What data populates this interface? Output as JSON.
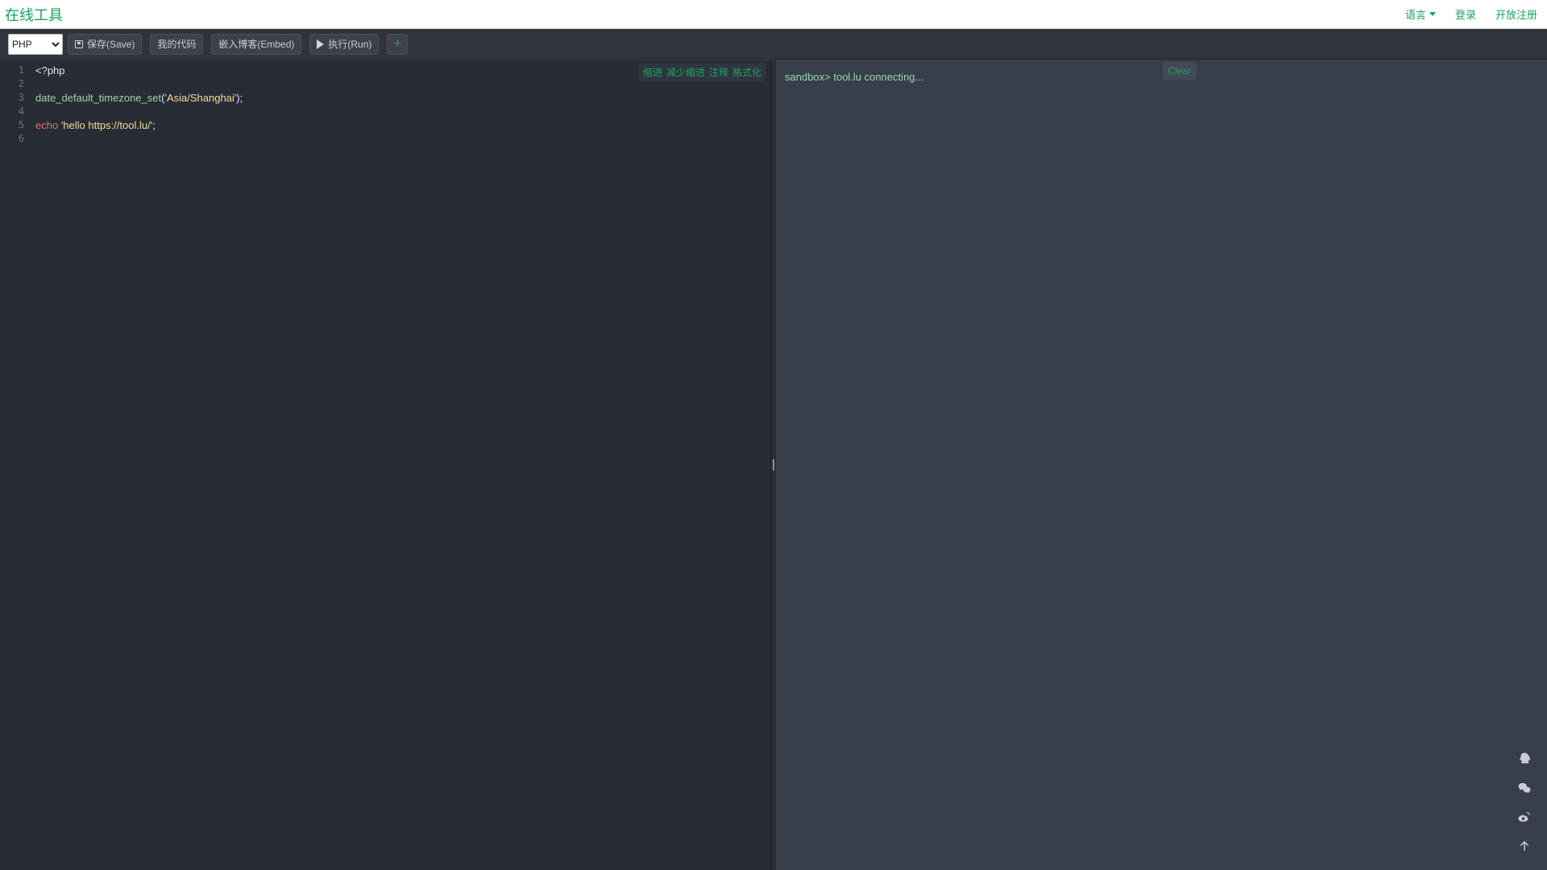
{
  "navbar": {
    "brand": "在线工具",
    "language": "语言",
    "login": "登录",
    "register": "开放注册"
  },
  "toolbar": {
    "language_select": {
      "value": "PHP",
      "options": [
        "PHP"
      ]
    },
    "save_label": "保存(Save)",
    "my_code_label": "我的代码",
    "embed_label": "嵌入博客(Embed)",
    "run_label": "执行(Run)",
    "add_label": "+"
  },
  "editor": {
    "tools": [
      "缩进",
      "减少缩进",
      "注释",
      "格式化"
    ],
    "line_numbers": [
      "1",
      "2",
      "3",
      "4",
      "5",
      "6"
    ],
    "lines": {
      "l1": "<?php",
      "l3_fn": "date_default_timezone_set",
      "l3_open": "(",
      "l3_str": "'Asia/Shanghai'",
      "l3_close": ");",
      "l5_kw": "echo",
      "l5_str": "'hello https://tool.lu/'",
      "l5_end": ";"
    }
  },
  "output": {
    "clear_label": "Clear",
    "console_text": "sandbox> tool.lu connecting..."
  },
  "side_icons": [
    "qq-icon",
    "wechat-icon",
    "weibo-icon",
    "back-to-top-icon"
  ],
  "colors": {
    "accent": "#1aa260",
    "editor_bg": "#282c35",
    "output_bg": "#383e4b"
  }
}
